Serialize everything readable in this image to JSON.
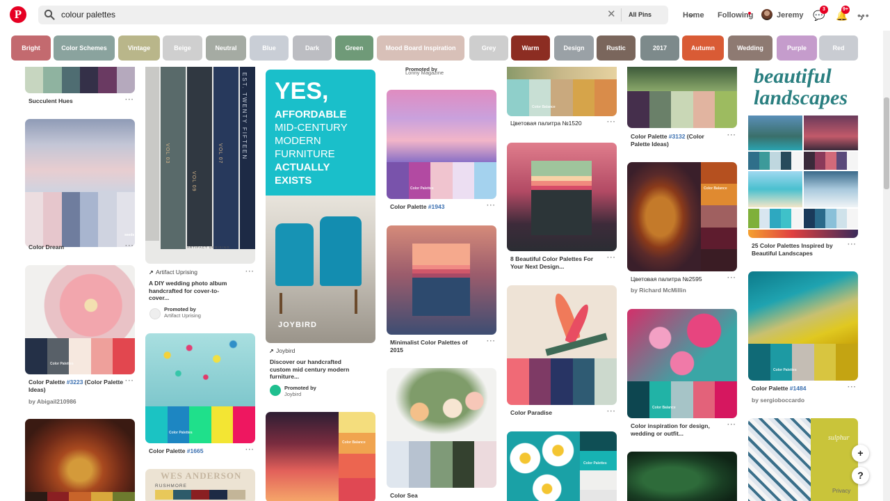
{
  "header": {
    "search_query": "colour palettes",
    "scope": "All Pins",
    "nav_home": "Home",
    "nav_following": "Following",
    "user_name": "Jeremy",
    "messages_badge": "3",
    "notifications_badge": "9+",
    "icons": [
      "pinterest-logo",
      "search-icon",
      "clear-icon",
      "chevron-down-icon",
      "avatar",
      "messages-icon",
      "notifications-icon",
      "more-icon"
    ]
  },
  "guides": [
    {
      "label": "Bright",
      "color": "#c36a6f"
    },
    {
      "label": "Color Schemes",
      "color": "#8aa39e"
    },
    {
      "label": "Vintage",
      "color": "#b9b68a"
    },
    {
      "label": "Beige",
      "color": "#cfcfcf"
    },
    {
      "label": "Neutral",
      "color": "#a5aba3"
    },
    {
      "label": "Blue",
      "color": "#c9ced6"
    },
    {
      "label": "Dark",
      "color": "#bcbdc2"
    },
    {
      "label": "Green",
      "color": "#6f9a78"
    },
    {
      "label": "Mood Board Inspiration",
      "color": "#d8c0b8"
    },
    {
      "label": "Grey",
      "color": "#cecece"
    },
    {
      "label": "Warm",
      "color": "#8c2d22"
    },
    {
      "label": "Design",
      "color": "#9aa1a6"
    },
    {
      "label": "Rustic",
      "color": "#7a665c"
    },
    {
      "label": "2017",
      "color": "#7d8a8b"
    },
    {
      "label": "Autumn",
      "color": "#d95b35"
    },
    {
      "label": "Wedding",
      "color": "#8e7a72"
    },
    {
      "label": "Purple",
      "color": "#c59ccc"
    },
    {
      "label": "Red",
      "color": "#c9ccd2"
    }
  ],
  "pins": {
    "c1a": {
      "title": "Succulent Hues"
    },
    "c1b": {
      "title": "Color Dream",
      "brand": "seeds"
    },
    "c1c": {
      "title_pre": "Color Palette ",
      "title_link": "#3223",
      "title_post": " (Color Palette Ideas)",
      "author": "by Abigail210986",
      "wm": "Color Palettes"
    },
    "c2a": {
      "source": "Artifact Uprising",
      "title": "A DIY wedding photo album handcrafted for cover-to-cover...",
      "promoted": "Promoted by",
      "promoter": "Artifact Uprising",
      "spines": [
        "VOL 03",
        "VOL 09",
        "VOL 07",
        "EST. TWENTY FIFTEEN"
      ],
      "book_brand": "ARTIFACT UPRISING"
    },
    "c2b": {
      "title_pre": "Color Palette ",
      "title_link": "#1665",
      "wm": "Color Palettes"
    },
    "c2c": {
      "top": "WES ANDERSON",
      "sub": "RUSHMORE"
    },
    "c3a": {
      "ad_l1": "YES,",
      "ad_l2": "AFFORDABLE",
      "ad_l3": "MID-CENTURY",
      "ad_l4": "MODERN",
      "ad_l5": "FURNITURE",
      "ad_l6": "ACTUALLY",
      "ad_l7": "EXISTS",
      "brand": "JOYBIRD",
      "source": "Joybird",
      "title": "Discover our handcrafted custom mid century modern furniture...",
      "promoted": "Promoted by",
      "promoter": "Joybird"
    },
    "c3b": {
      "wm": "Color Balance"
    },
    "c4a": {
      "promoted": "Promoted by",
      "promoter": "Lonny Magazine"
    },
    "c4b": {
      "title_pre": "Color Palette ",
      "title_link": "#1943",
      "wm": "Color Palettes"
    },
    "c4c": {
      "title": "Minimalist Color Palettes of 2015"
    },
    "c4d": {
      "title": "Color Sea"
    },
    "c5a": {
      "title": "Цветовая палитра №1520",
      "wm": "Color Balance"
    },
    "c5b": {
      "title": "8 Beautiful Color Palettes For Your Next Design..."
    },
    "c5c": {
      "title": "Color Paradise"
    },
    "c5d": {
      "wm": "Color Palettes"
    },
    "c6a": {
      "title_pre": "Color Palette ",
      "title_link": "#3132",
      "title_post": " (Color Palette Ideas)"
    },
    "c6b": {
      "title": "Цветовая палитра №2595",
      "author": "by Richard McMillin",
      "wm": "Color Balance"
    },
    "c6c": {
      "title": "Color inspiration for design, wedding or outfit...",
      "wm": "Color Balance"
    },
    "c7a": {
      "script1": "beautiful",
      "script2": "landscapes",
      "title": "25 Color Palettes Inspired by Beautiful Landscapes"
    },
    "c7b": {
      "title_pre": "Color Palette ",
      "title_link": "#1484",
      "author": "by sergioboccardo",
      "wm": "Color Palettes"
    },
    "c7c": {
      "word": "sulphur"
    }
  },
  "floating": {
    "add_label": "+",
    "help_label": "?",
    "privacy": "Privacy"
  }
}
